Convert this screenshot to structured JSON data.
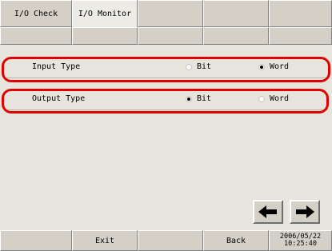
{
  "tabs": [
    {
      "label": "I/O Check",
      "active": false
    },
    {
      "label": "I/O Monitor",
      "active": true
    }
  ],
  "settings": {
    "input_type": {
      "label": "Input Type",
      "options": [
        "Bit",
        "Word"
      ],
      "selected": "Word"
    },
    "output_type": {
      "label": "Output Type",
      "options": [
        "Bit",
        "Word"
      ],
      "selected": "Bit"
    }
  },
  "footer": {
    "exit_label": "Exit",
    "back_label": "Back",
    "date": "2006/05/22",
    "time": "10:25:40"
  },
  "icons": {
    "prev": "arrow-left-icon",
    "next": "arrow-right-icon"
  },
  "colors": {
    "highlight": "#e00000"
  }
}
